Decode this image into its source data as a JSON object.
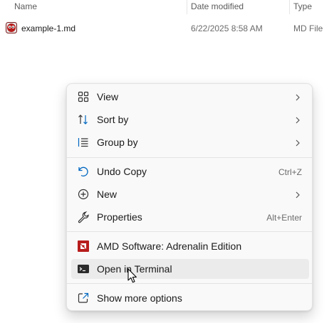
{
  "columns": {
    "name": "Name",
    "date_modified": "Date modified",
    "type": "Type"
  },
  "file": {
    "name": "example-1.md",
    "date_modified": "6/22/2025 8:58 AM",
    "type": "MD File",
    "icon": "markdown-file-icon"
  },
  "context_menu": {
    "view": {
      "label": "View",
      "icon": "grid-icon"
    },
    "sort_by": {
      "label": "Sort by",
      "icon": "sort-icon"
    },
    "group_by": {
      "label": "Group by",
      "icon": "list-icon"
    },
    "undo_copy": {
      "label": "Undo Copy",
      "shortcut": "Ctrl+Z",
      "icon": "undo-icon"
    },
    "new": {
      "label": "New",
      "icon": "plus-circle-icon"
    },
    "properties": {
      "label": "Properties",
      "shortcut": "Alt+Enter",
      "icon": "wrench-icon"
    },
    "amd_software": {
      "label": "AMD Software: Adrenalin Edition",
      "icon": "amd-logo-icon"
    },
    "open_terminal": {
      "label": "Open in Terminal",
      "icon": "terminal-icon"
    },
    "show_more": {
      "label": "Show more options",
      "icon": "external-icon"
    }
  },
  "colors": {
    "menu_background": "#f9f9f9",
    "hover_background": "#ebebeb",
    "icon_accent": "#0067c0",
    "amd_red": "#b71c1c"
  }
}
